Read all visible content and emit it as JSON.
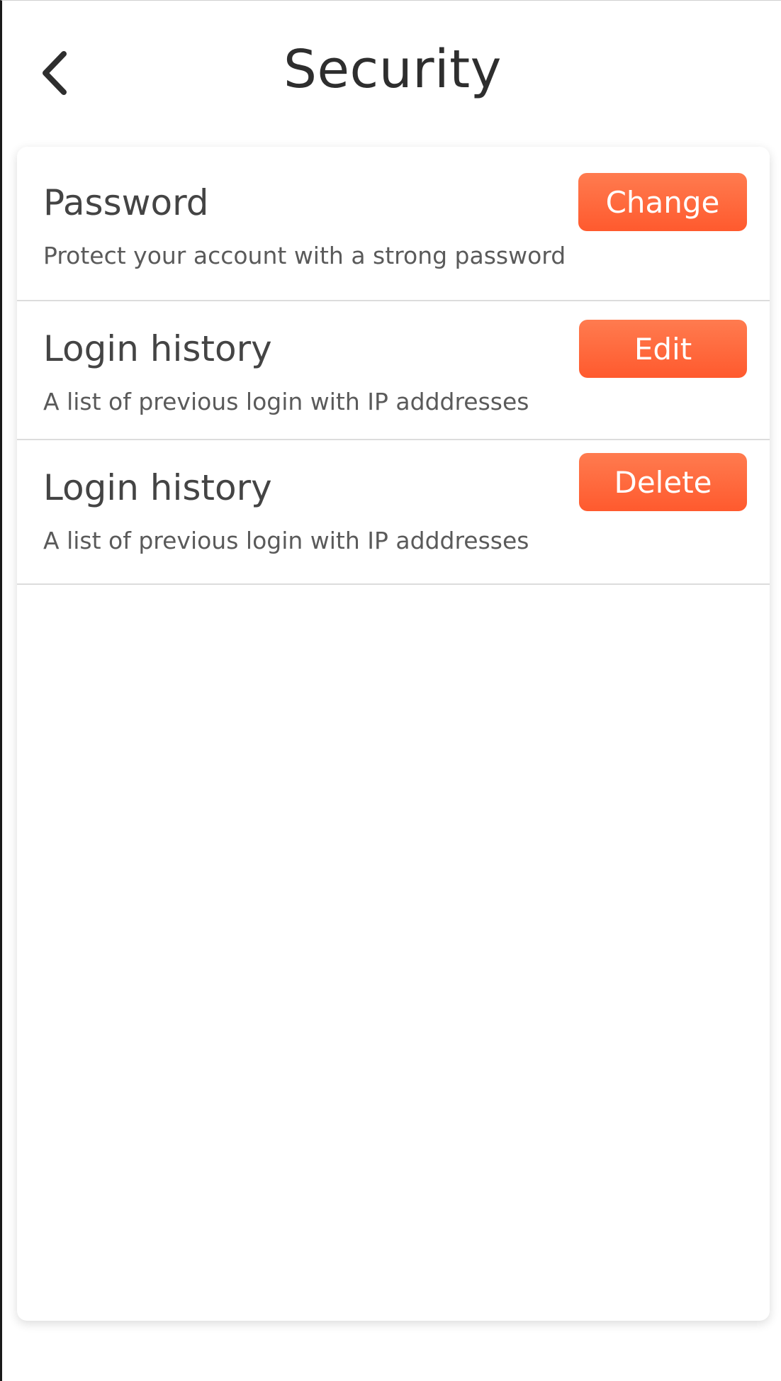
{
  "header": {
    "title": "Security",
    "back_icon": "chevron-left-icon"
  },
  "colors": {
    "accent": "#ff6a3d",
    "text": "#444444",
    "divider": "#dcdcdc"
  },
  "settings": [
    {
      "title": "Password",
      "description": "Protect your account with a strong password",
      "action_label": "Change"
    },
    {
      "title": "Login history",
      "description": "A list of previous login with IP adddresses",
      "action_label": "Edit"
    },
    {
      "title": "Login history",
      "description": "A list of previous login with IP adddresses",
      "action_label": "Delete"
    }
  ]
}
